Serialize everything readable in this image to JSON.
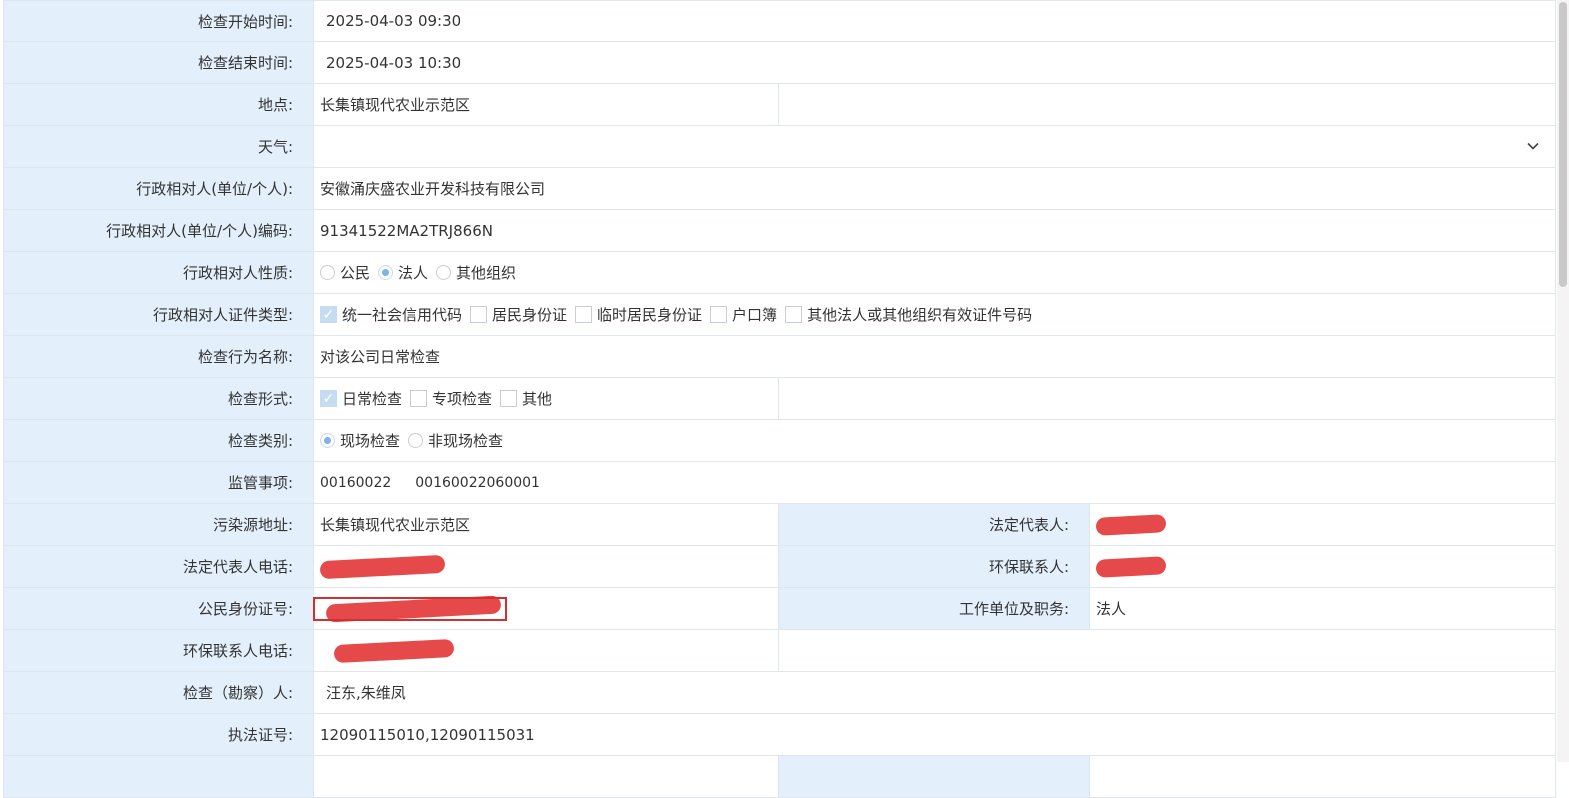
{
  "fields": {
    "start_time": {
      "label": "检查开始时间:",
      "value": "2025-04-03 09:30"
    },
    "end_time": {
      "label": "检查结束时间:",
      "value": "2025-04-03 10:30"
    },
    "location": {
      "label": "地点:",
      "value": "长集镇现代农业示范区"
    },
    "weather": {
      "label": "天气:",
      "value": ""
    },
    "party": {
      "label": "行政相对人(单位/个人):",
      "value": "安徽涌庆盛农业开发科技有限公司"
    },
    "party_code": {
      "label": "行政相对人(单位/个人)编码:",
      "value": "91341522MA2TRJ866N"
    },
    "party_nature": {
      "label": "行政相对人性质:",
      "options": [
        "公民",
        "法人",
        "其他组织"
      ],
      "selected": "法人"
    },
    "cert_type": {
      "label": "行政相对人证件类型:",
      "options": [
        "统一社会信用代码",
        "居民身份证",
        "临时居民身份证",
        "户口簿",
        "其他法人或其他组织有效证件号码"
      ],
      "checked": [
        "统一社会信用代码"
      ]
    },
    "inspection_name": {
      "label": "检查行为名称:",
      "value": "对该公司日常检查"
    },
    "inspection_form": {
      "label": "检查形式:",
      "options": [
        "日常检查",
        "专项检查",
        "其他"
      ],
      "checked": [
        "日常检查"
      ]
    },
    "inspection_category": {
      "label": "检查类别:",
      "options": [
        "现场检查",
        "非现场检查"
      ],
      "selected": "现场检查"
    },
    "supervision": {
      "label": "监管事项:",
      "code1": "00160022",
      "code2": "00160022060001"
    },
    "pollution_address": {
      "label": "污染源地址:",
      "value": "长集镇现代农业示范区"
    },
    "legal_rep": {
      "label": "法定代表人:"
    },
    "legal_rep_phone": {
      "label": "法定代表人电话:"
    },
    "env_contact": {
      "label": "环保联系人:"
    },
    "citizen_id": {
      "label": "公民身份证号:"
    },
    "work_unit": {
      "label": "工作单位及职务:",
      "value": "法人"
    },
    "env_contact_phone": {
      "label": "环保联系人电话:"
    },
    "inspectors": {
      "label": "检查（勘察）人:",
      "value": "汪东,朱维凤"
    },
    "license_no": {
      "label": "执法证号:",
      "value": "12090115010,12090115031"
    }
  },
  "icons": {
    "select_arrow": "chevron-down-icon",
    "check_mark": "✓"
  },
  "colors": {
    "label_bg": "#e3f0fc",
    "border": "#dfe6ee",
    "redaction": "#e33b3b",
    "radio_on": "#7cb3e9"
  }
}
